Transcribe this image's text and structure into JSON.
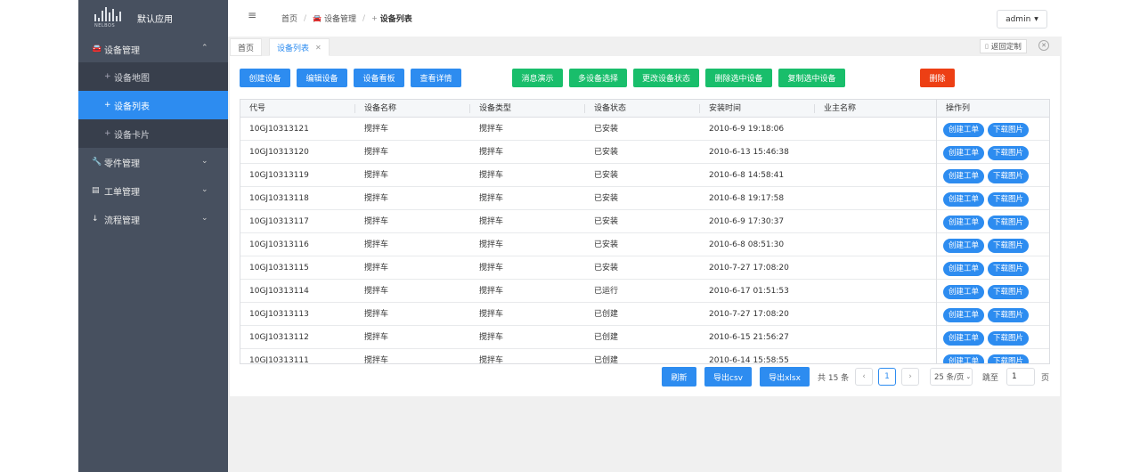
{
  "sidebar": {
    "logo_text": "NELBOS",
    "app_name": "默认应用",
    "groups": [
      {
        "label": "设备管理",
        "icon": "car-icon",
        "children": [
          "设备地图",
          "设备列表",
          "设备卡片"
        ]
      },
      {
        "label": "零件管理",
        "icon": "wrench-icon"
      },
      {
        "label": "工单管理",
        "icon": "list-icon"
      },
      {
        "label": "流程管理",
        "icon": "arrow-down-icon"
      }
    ],
    "active_item": "设备列表"
  },
  "header": {
    "breadcrumb": [
      "首页",
      "设备管理",
      "设备列表"
    ],
    "user": "admin"
  },
  "tabs": {
    "items": [
      "首页",
      "设备列表"
    ],
    "active": "设备列表",
    "back_label": "返回定制"
  },
  "toolbar": {
    "create": "创建设备",
    "edit": "编辑设备",
    "board": "设备看板",
    "detail": "查看详情",
    "message": "消息演示",
    "multi_select": "多设备选择",
    "change_status": "更改设备状态",
    "delete_selected": "删除选中设备",
    "copy_selected": "复制选中设备",
    "delete": "删除"
  },
  "table": {
    "columns": [
      "代号",
      "设备名称",
      "设备类型",
      "设备状态",
      "安装时间",
      "业主名称",
      "操作列"
    ],
    "op_create": "创建工单",
    "op_download": "下载图片",
    "rows": [
      [
        "10GJ10313121",
        "搅拌车",
        "搅拌车",
        "已安装",
        "2010-6-9 19:18:06",
        ""
      ],
      [
        "10GJ10313120",
        "搅拌车",
        "搅拌车",
        "已安装",
        "2010-6-13 15:46:38",
        ""
      ],
      [
        "10GJ10313119",
        "搅拌车",
        "搅拌车",
        "已安装",
        "2010-6-8 14:58:41",
        ""
      ],
      [
        "10GJ10313118",
        "搅拌车",
        "搅拌车",
        "已安装",
        "2010-6-8 19:17:58",
        ""
      ],
      [
        "10GJ10313117",
        "搅拌车",
        "搅拌车",
        "已安装",
        "2010-6-9 17:30:37",
        ""
      ],
      [
        "10GJ10313116",
        "搅拌车",
        "搅拌车",
        "已安装",
        "2010-6-8 08:51:30",
        ""
      ],
      [
        "10GJ10313115",
        "搅拌车",
        "搅拌车",
        "已安装",
        "2010-7-27 17:08:20",
        ""
      ],
      [
        "10GJ10313114",
        "搅拌车",
        "搅拌车",
        "已运行",
        "2010-6-17 01:51:53",
        ""
      ],
      [
        "10GJ10313113",
        "搅拌车",
        "搅拌车",
        "已创建",
        "2010-7-27 17:08:20",
        ""
      ],
      [
        "10GJ10313112",
        "搅拌车",
        "搅拌车",
        "已创建",
        "2010-6-15 21:56:27",
        ""
      ],
      [
        "10GJ10313111",
        "搅拌车",
        "搅拌车",
        "已创建",
        "2010-6-14 15:58:55",
        ""
      ]
    ]
  },
  "pager": {
    "refresh": "刷新",
    "export_csv": "导出csv",
    "export_xlsx": "导出xlsx",
    "total": "共 15 条",
    "prev": "‹",
    "page": "1",
    "next": "›",
    "page_size": "25 条/页",
    "jump_label": "跳至",
    "jump_value": "1",
    "page_unit": "页"
  },
  "colors": {
    "primary": "#2d8cf0",
    "success": "#19be6b",
    "danger": "#ed3f14",
    "sidebar": "#47505f"
  }
}
